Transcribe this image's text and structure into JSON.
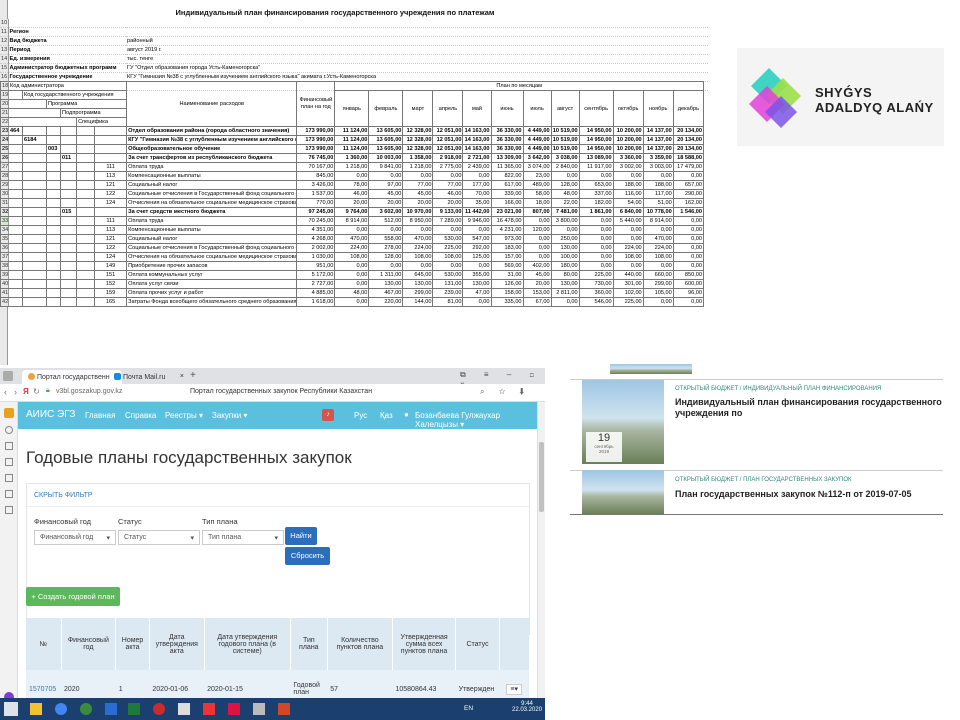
{
  "spreadsheet": {
    "title": "Индивидуальный план финансирования государственного учреждения по платежам",
    "info": [
      {
        "row": "10",
        "label": "",
        "value": ""
      },
      {
        "row": "11",
        "label": "Регион",
        "value": ""
      },
      {
        "row": "12",
        "label": "Вид бюджета",
        "value": "районный"
      },
      {
        "row": "13",
        "label": "Период",
        "value": "август 2019 г."
      },
      {
        "row": "14",
        "label": "Ед. измерения",
        "value": "тыс. тенге"
      },
      {
        "row": "15",
        "label": "Администратор бюджетных программ",
        "value": "ГУ \"Отдел образования города Усть-Каменогорска\""
      },
      {
        "row": "16",
        "label": "Государственное учреждение",
        "value": "КГУ \"Гимназия №38 с углубленным изучением английского языка\" акимата г.Усть-Каменогорска"
      },
      {
        "row": "17",
        "label": "",
        "value": ""
      }
    ],
    "header": {
      "codes": [
        "Код администратора",
        "Код государственного учреждения",
        "Программа",
        "Подпрограмма",
        "Специфика"
      ],
      "name": "Наименование расходов",
      "annual": "Финансовый план на год",
      "plan_by_month": "План по месяцам",
      "months": [
        "январь",
        "февраль",
        "март",
        "апрель",
        "май",
        "июнь",
        "июль",
        "август",
        "сентябрь",
        "октябрь",
        "ноябрь",
        "декабрь"
      ],
      "row_nums": [
        "18",
        "19",
        "20",
        "21",
        "22"
      ]
    },
    "rows": [
      {
        "n": "23",
        "c1": "464",
        "c2": "",
        "c3": "",
        "c4": "",
        "c5": "",
        "name": "Отдел образования района (города областного значения)",
        "bold": true,
        "v": [
          "173 990,00",
          "11 124,00",
          "13 605,00",
          "12 328,00",
          "12 051,00",
          "14 163,00",
          "36 330,00",
          "4 449,00",
          "10 519,00",
          "14 950,00",
          "10 200,00",
          "14 137,00",
          "20 134,00"
        ]
      },
      {
        "n": "24",
        "c1": "",
        "c2": "6184",
        "c3": "",
        "c4": "",
        "c5": "",
        "name": "КГУ \"Гимназия №38 с углубленным изучением английского языка\" акимата г.Усть-Каменогорска",
        "bold": true,
        "v": [
          "173 990,00",
          "11 124,00",
          "13 605,00",
          "12 328,00",
          "12 051,00",
          "14 163,00",
          "36 330,00",
          "4 449,00",
          "10 519,00",
          "14 950,00",
          "10 200,00",
          "14 137,00",
          "20 134,00"
        ]
      },
      {
        "n": "25",
        "c1": "",
        "c2": "",
        "c3": "003",
        "c4": "",
        "c5": "",
        "name": "Общеобразовательное обучение",
        "bold": true,
        "v": [
          "173 990,00",
          "11 124,00",
          "13 605,00",
          "12 328,00",
          "12 051,00",
          "14 163,00",
          "36 330,00",
          "4 449,00",
          "10 519,00",
          "14 950,00",
          "10 200,00",
          "14 137,00",
          "20 134,00"
        ]
      },
      {
        "n": "26",
        "c1": "",
        "c2": "",
        "c3": "",
        "c4": "011",
        "c5": "",
        "name": "За счет трансфертов из республиканского бюджета",
        "bold": true,
        "v": [
          "76 745,00",
          "1 360,00",
          "10 003,00",
          "1 358,00",
          "2 918,00",
          "2 721,00",
          "13 309,00",
          "3 642,00",
          "3 038,00",
          "13 089,00",
          "3 360,00",
          "3 359,00",
          "18 588,00"
        ]
      },
      {
        "n": "27",
        "c1": "",
        "c2": "",
        "c3": "",
        "c4": "",
        "c5": "111",
        "name": "Оплата труда",
        "bold": false,
        "v": [
          "70 167,00",
          "1 218,00",
          "9 841,00",
          "1 218,00",
          "2 775,00",
          "2 439,00",
          "11 365,00",
          "3 074,00",
          "2 840,00",
          "11 917,00",
          "3 002,00",
          "3 003,00",
          "17 479,00"
        ]
      },
      {
        "n": "28",
        "c1": "",
        "c2": "",
        "c3": "",
        "c4": "",
        "c5": "113",
        "name": "Компенсационные выплаты",
        "bold": false,
        "v": [
          "845,00",
          "0,00",
          "0,00",
          "0,00",
          "0,00",
          "0,00",
          "822,00",
          "23,00",
          "0,00",
          "0,00",
          "0,00",
          "0,00",
          "0,00"
        ]
      },
      {
        "n": "29",
        "c1": "",
        "c2": "",
        "c3": "",
        "c4": "",
        "c5": "121",
        "name": "Социальный налог",
        "bold": false,
        "v": [
          "3 426,00",
          "78,00",
          "97,00",
          "77,00",
          "77,00",
          "177,00",
          "617,00",
          "489,00",
          "128,00",
          "653,00",
          "188,00",
          "188,00",
          "657,00"
        ]
      },
      {
        "n": "30",
        "c1": "",
        "c2": "",
        "c3": "",
        "c4": "",
        "c5": "122",
        "name": "Социальные отчисления в Государственный фонд социального страхования",
        "bold": false,
        "v": [
          "1 537,00",
          "46,00",
          "45,00",
          "45,00",
          "46,00",
          "70,00",
          "339,00",
          "58,00",
          "48,00",
          "337,00",
          "116,00",
          "117,00",
          "290,00"
        ]
      },
      {
        "n": "31",
        "c1": "",
        "c2": "",
        "c3": "",
        "c4": "",
        "c5": "124",
        "name": "Отчисления на обязательное социальное медицинское страхование",
        "bold": false,
        "v": [
          "770,00",
          "20,00",
          "20,00",
          "20,00",
          "20,00",
          "35,00",
          "166,00",
          "18,00",
          "22,00",
          "182,00",
          "54,00",
          "51,00",
          "162,00"
        ]
      },
      {
        "n": "32",
        "c1": "",
        "c2": "",
        "c3": "",
        "c4": "015",
        "c5": "",
        "name": "За счет средств местного бюджета",
        "bold": true,
        "v": [
          "97 245,00",
          "9 764,00",
          "3 602,00",
          "10 970,00",
          "9 133,00",
          "11 442,00",
          "23 021,00",
          "807,00",
          "7 481,00",
          "1 861,00",
          "6 840,00",
          "10 778,00",
          "1 546,00"
        ]
      },
      {
        "n": "33",
        "c1": "",
        "c2": "",
        "c3": "",
        "c4": "",
        "c5": "111",
        "name": "Оплата труда",
        "bold": false,
        "sel": true,
        "v": [
          "70 245,00",
          "8 914,00",
          "512,00",
          "8 950,00",
          "7 289,00",
          "9 946,00",
          "16 478,00",
          "0,00",
          "3 800,00",
          "0,00",
          "5 440,00",
          "8 914,00",
          "0,00"
        ]
      },
      {
        "n": "34",
        "c1": "",
        "c2": "",
        "c3": "",
        "c4": "",
        "c5": "113",
        "name": "Компенсационные выплаты",
        "bold": false,
        "v": [
          "4 351,00",
          "0,00",
          "0,00",
          "0,00",
          "0,00",
          "0,00",
          "4 231,00",
          "120,00",
          "0,00",
          "0,00",
          "0,00",
          "0,00",
          "0,00"
        ]
      },
      {
        "n": "35",
        "c1": "",
        "c2": "",
        "c3": "",
        "c4": "",
        "c5": "121",
        "name": "Социальный налог",
        "bold": false,
        "v": [
          "4 268,00",
          "470,00",
          "558,00",
          "470,00",
          "530,00",
          "547,00",
          "973,00",
          "0,00",
          "250,00",
          "0,00",
          "0,00",
          "470,00",
          "0,00"
        ]
      },
      {
        "n": "36",
        "c1": "",
        "c2": "",
        "c3": "",
        "c4": "",
        "c5": "122",
        "name": "Социальные отчисления в Государственный фонд социального страхования",
        "bold": false,
        "v": [
          "2 002,00",
          "224,00",
          "278,00",
          "224,00",
          "225,00",
          "292,00",
          "183,00",
          "0,00",
          "130,00",
          "0,00",
          "224,00",
          "224,00",
          "0,00"
        ]
      },
      {
        "n": "37",
        "c1": "",
        "c2": "",
        "c3": "",
        "c4": "",
        "c5": "124",
        "name": "Отчисления на обязательное социальное медицинское страхование",
        "bold": false,
        "v": [
          "1 030,00",
          "108,00",
          "128,00",
          "108,00",
          "108,00",
          "125,00",
          "157,00",
          "0,00",
          "100,00",
          "0,00",
          "108,00",
          "108,00",
          "0,00"
        ]
      },
      {
        "n": "38",
        "c1": "",
        "c2": "",
        "c3": "",
        "c4": "",
        "c5": "149",
        "name": "Приобретение прочих запасов",
        "bold": false,
        "v": [
          "951,00",
          "0,00",
          "0,00",
          "0,00",
          "0,00",
          "0,00",
          "569,00",
          "402,00",
          "180,00",
          "0,00",
          "0,00",
          "0,00",
          "0,00"
        ]
      },
      {
        "n": "39",
        "c1": "",
        "c2": "",
        "c3": "",
        "c4": "",
        "c5": "151",
        "name": "Оплата коммунальных услуг",
        "bold": false,
        "v": [
          "5 172,00",
          "0,00",
          "1 311,00",
          "645,00",
          "530,00",
          "355,00",
          "31,00",
          "45,00",
          "80,00",
          "225,00",
          "440,00",
          "660,00",
          "850,00"
        ]
      },
      {
        "n": "40",
        "c1": "",
        "c2": "",
        "c3": "",
        "c4": "",
        "c5": "152",
        "name": "Оплата услуг связи",
        "bold": false,
        "v": [
          "2 727,00",
          "0,00",
          "130,00",
          "130,00",
          "131,00",
          "130,00",
          "126,00",
          "20,00",
          "130,00",
          "730,00",
          "301,00",
          "299,00",
          "600,00"
        ]
      },
      {
        "n": "41",
        "c1": "",
        "c2": "",
        "c3": "",
        "c4": "",
        "c5": "159",
        "name": "Оплата прочих услуг и работ",
        "bold": false,
        "v": [
          "4 885,00",
          "48,00",
          "467,00",
          "299,00",
          "239,00",
          "47,00",
          "158,00",
          "153,00",
          "2 811,00",
          "360,00",
          "102,00",
          "105,00",
          "96,00"
        ]
      },
      {
        "n": "42",
        "c1": "",
        "c2": "",
        "c3": "",
        "c4": "",
        "c5": "165",
        "name": "Затраты Фонда всеобщего обязательного среднего образования",
        "bold": false,
        "v": [
          "1 618,00",
          "0,00",
          "220,00",
          "144,00",
          "81,00",
          "0,00",
          "335,00",
          "67,00",
          "0,00",
          "546,00",
          "225,00",
          "0,00",
          "0,00"
        ]
      }
    ]
  },
  "logo": {
    "line1": "SHYǴYS",
    "line2": "ADALDYQ ALAŃY"
  },
  "browser": {
    "tabs": [
      "Портал государственн",
      "Почта Mail.ru"
    ],
    "url": "v3bl.goszakup.gov.kz",
    "page_title": "Портал государственных закупок Республики Казахстан",
    "nav": {
      "brand": "АИИС ЭГЗ",
      "items": [
        "Главная",
        "Справка",
        "Реестры ▾",
        "Закупки ▾"
      ],
      "lang": [
        "Рус",
        "Қаз"
      ],
      "user": "Бозанбаева Гулжаухар Халелцызы ▾"
    },
    "heading": "Годовые планы государственных закупок",
    "filter_link": "СКРЫТЬ ФИЛЬТР",
    "filters": [
      {
        "label": "Финансовый год",
        "placeholder": "Финансовый год"
      },
      {
        "label": "Статус",
        "placeholder": "Статус"
      },
      {
        "label": "Тип плана",
        "placeholder": "Тип плана"
      }
    ],
    "find_btn": "Найти",
    "reset_btn": "Сбросить",
    "create_btn": "+ Создать годовой план",
    "table": {
      "columns": [
        "№",
        "Финансовый год",
        "Номер акта",
        "Дата утверждения акта",
        "Дата утверждения годового плана (в системе)",
        "Тип плана",
        "Количество пунктов плана",
        "Утвержденная сумма всех пунктов плана",
        "Статус"
      ],
      "rows": [
        [
          "1570705",
          "2020",
          "1",
          "2020-01-06",
          "2020-01-15",
          "Годовой план",
          "57",
          "10580864.43",
          "Утвержден"
        ]
      ]
    }
  },
  "taskbar": {
    "lang": "EN",
    "time": "9:44",
    "date": "22.03.2020"
  },
  "news": [
    {
      "category": "ОТКРЫТЫЙ БЮДЖЕТ / ИНДИВИДУАЛЬНЫЙ ПЛАН ФИНАНСИРОВАНИЯ",
      "title": "Индивидуальный план финансирования государственного учреждения по",
      "day": "19",
      "month": "сентябрь",
      "year": "2019"
    },
    {
      "category": "ОТКРЫТЫЙ БЮДЖЕТ / ПЛАН ГОСУДАРСТВЕННЫХ ЗАКУПОК",
      "title": "План государственных закупок №112-п от 2019-07-05"
    }
  ]
}
